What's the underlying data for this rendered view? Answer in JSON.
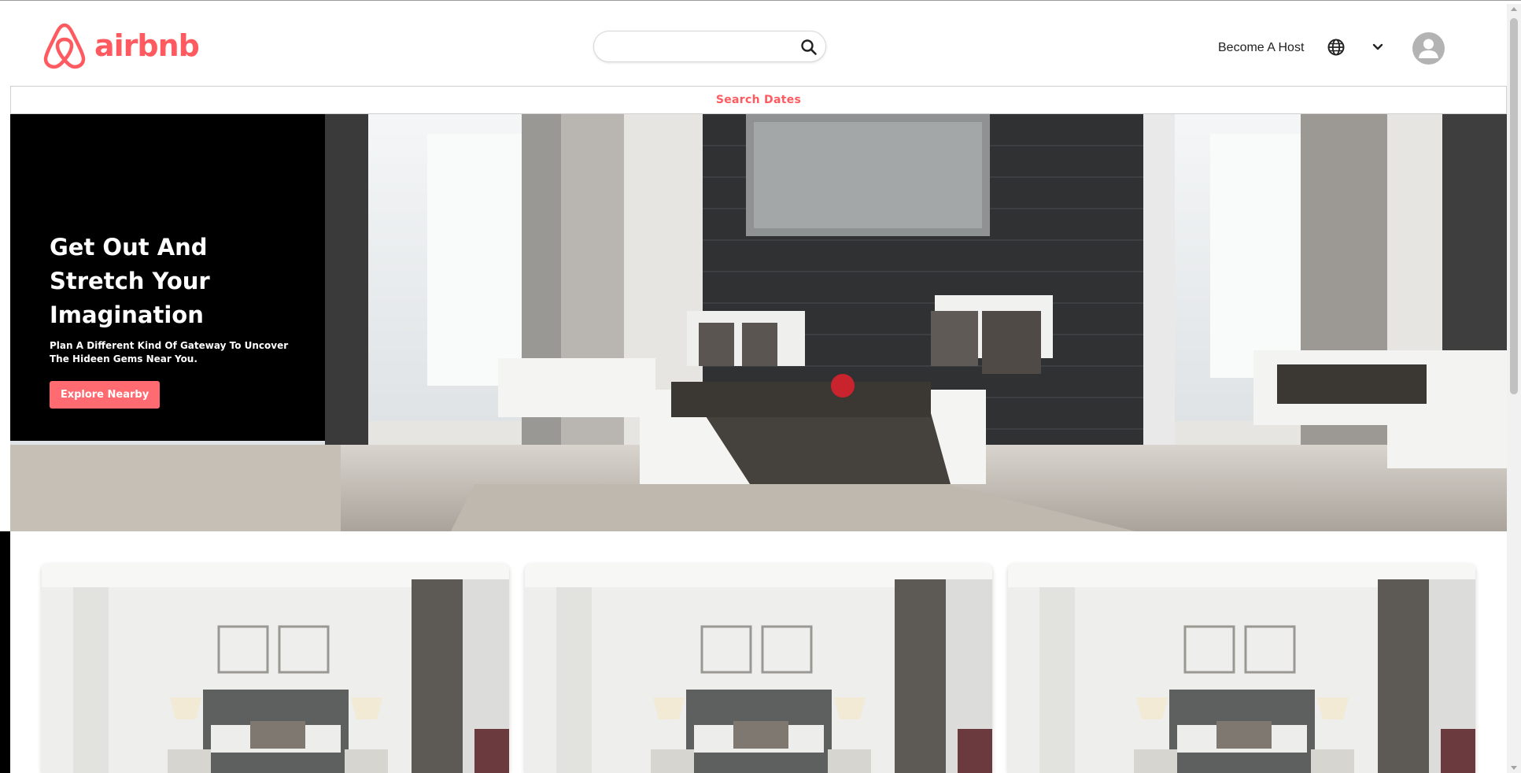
{
  "brand": {
    "name": "airbnb",
    "color": "#ff5a5f"
  },
  "header": {
    "search": {
      "value": "",
      "placeholder": ""
    },
    "host_link": "Become A Host",
    "icons": [
      "search-icon",
      "globe-icon",
      "chevron-down-icon",
      "user-avatar-icon"
    ]
  },
  "dates_bar": {
    "label": "Search Dates"
  },
  "hero": {
    "title": "Get Out And Stretch Your Imagination",
    "subtitle": "Plan A Different Kind Of Gateway To Uncover The Hideen Gems Near You.",
    "button_label": "Explore Nearby",
    "button_color": "#ff6b70"
  },
  "cards": [
    {
      "image": "bedroom-photo"
    },
    {
      "image": "bedroom-photo"
    },
    {
      "image": "bedroom-photo"
    }
  ]
}
